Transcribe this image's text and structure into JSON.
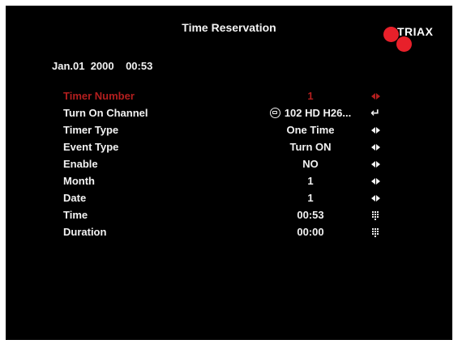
{
  "header": {
    "title": "Time Reservation",
    "brand": "TRIAX",
    "brand_color": "#e8202a"
  },
  "clock": {
    "date": "Jan.01  2000",
    "time": "00:53"
  },
  "rows": [
    {
      "label": "Timer Number",
      "value": "1",
      "control": "left-right-arrows-icon",
      "selected": true
    },
    {
      "label": "Turn On Channel",
      "value": "102 HD H26...",
      "control": "enter-icon",
      "value_icon": "channel-icon"
    },
    {
      "label": "Timer Type",
      "value": "One Time",
      "control": "left-right-arrows-icon"
    },
    {
      "label": "Event Type",
      "value": "Turn ON",
      "control": "left-right-arrows-icon"
    },
    {
      "label": "Enable",
      "value": "NO",
      "control": "left-right-arrows-icon"
    },
    {
      "label": "Month",
      "value": "1",
      "control": "left-right-arrows-icon"
    },
    {
      "label": "Date",
      "value": "1",
      "control": "left-right-arrows-icon"
    },
    {
      "label": "Time",
      "value": "00:53",
      "control": "keypad-icon"
    },
    {
      "label": "Duration",
      "value": "00:00",
      "control": "keypad-icon"
    }
  ],
  "colors": {
    "background": "#000000",
    "text": "#f2f2f2",
    "selected": "#b31e1e"
  }
}
